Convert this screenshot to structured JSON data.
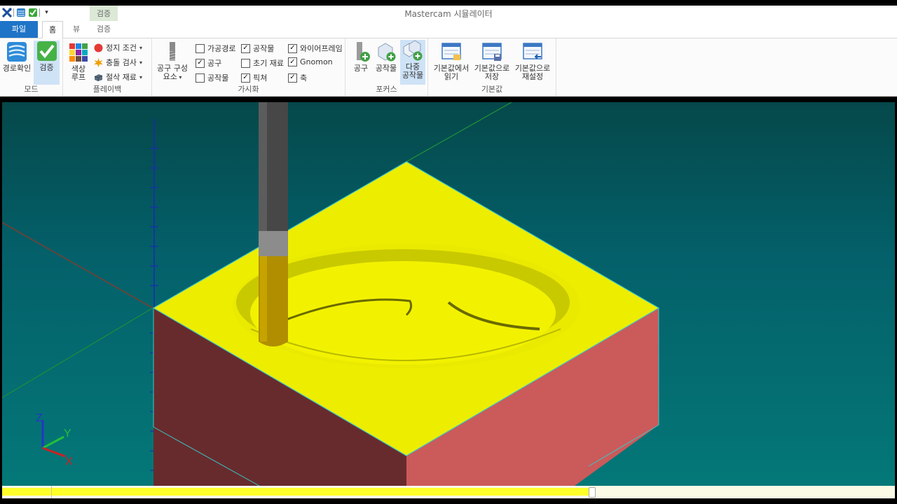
{
  "window": {
    "title": "Mastercam 시뮬레이터"
  },
  "context_tab": {
    "title": "검증"
  },
  "tabs": {
    "file": "파일",
    "home": "홈",
    "view": "뷰",
    "verify": "검증"
  },
  "groups": {
    "mode": {
      "label": "모드",
      "toolpath_review": "경로확인",
      "verify": "검증"
    },
    "playback": {
      "label": "플레이백",
      "color_loop_line1": "색상",
      "color_loop_line2": "루프",
      "stop_conditions": "정지 조건",
      "collision_check": "충돌 검사",
      "cut_stock": "절삭 재료"
    },
    "visibility": {
      "label": "가시화",
      "tool_components_line1": "공구 구성",
      "tool_components_line2": "요소",
      "checkboxes": [
        {
          "label": "가공경로",
          "checked": false
        },
        {
          "label": "공구",
          "checked": true
        },
        {
          "label": "공작물",
          "checked": false
        },
        {
          "label": "공작물",
          "checked": true
        },
        {
          "label": "초기 재료",
          "checked": false
        },
        {
          "label": "픽쳐",
          "checked": true
        },
        {
          "label": "와이어프레임",
          "checked": true
        },
        {
          "label": "Gnomon",
          "checked": true
        },
        {
          "label": "축",
          "checked": true
        }
      ]
    },
    "focus": {
      "label": "포커스",
      "tool": "공구",
      "workpiece": "공작물",
      "multi_line1": "다중",
      "multi_line2": "공작물"
    },
    "defaults": {
      "label": "기본값",
      "read_line1": "기본값에서",
      "read_line2": "읽기",
      "save_line1": "기본값으로",
      "save_line2": "저장",
      "reset_line1": "기본값으로",
      "reset_line2": "재설정"
    }
  },
  "gnomon": {
    "x": "X",
    "y": "Y",
    "z": "Z"
  },
  "playback_progress": 0.66,
  "colors": {
    "file_tab": "#1e74c7",
    "stock_top": "#eded00",
    "stock_left": "#682b2d",
    "stock_right": "#cb5a5a",
    "tool_shank": "#4a4a4a",
    "tool_flute": "#b08e00",
    "progress": "#ffff2a"
  }
}
